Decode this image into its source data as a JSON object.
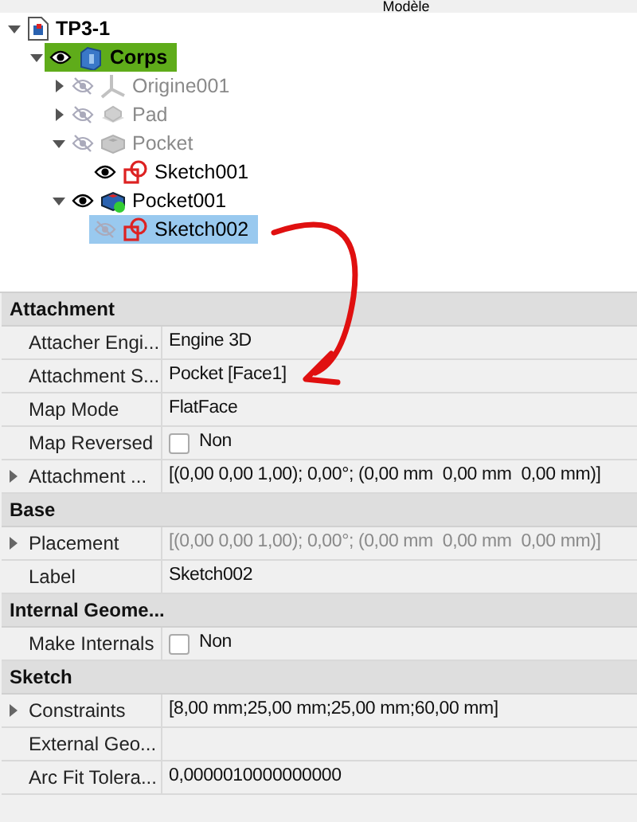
{
  "panel_title": "Modèle",
  "tree": [
    {
      "label": "TP3-1",
      "kind": "document",
      "expanded": true,
      "bold": true,
      "children": [
        {
          "label": "Corps",
          "kind": "body",
          "visible": true,
          "expanded": true,
          "bold": true,
          "active": true,
          "children": [
            {
              "label": "Origine001",
              "kind": "origin",
              "visible": false,
              "expanded": false,
              "dimmed": true,
              "has_children": true
            },
            {
              "label": "Pad",
              "kind": "pad",
              "visible": false,
              "expanded": false,
              "dimmed": true,
              "has_children": true
            },
            {
              "label": "Pocket",
              "kind": "pocket",
              "visible": false,
              "expanded": true,
              "dimmed": true,
              "children": [
                {
                  "label": "Sketch001",
                  "kind": "sketch",
                  "visible": true,
                  "dimmed": false
                }
              ]
            },
            {
              "label": "Pocket001",
              "kind": "pocket_tip",
              "visible": true,
              "expanded": true,
              "dimmed": false,
              "children": [
                {
                  "label": "Sketch002",
                  "kind": "sketch",
                  "visible": false,
                  "dimmed": false,
                  "selected": true
                }
              ]
            }
          ]
        }
      ]
    }
  ],
  "properties": [
    {
      "group": "Attachment",
      "rows": [
        {
          "name": "Attacher Engi...",
          "kind": "text",
          "value": "Engine 3D"
        },
        {
          "name": "Attachment S...",
          "kind": "text",
          "value": "Pocket [Face1]"
        },
        {
          "name": "Map Mode",
          "kind": "text",
          "value": "FlatFace"
        },
        {
          "name": "Map Reversed",
          "kind": "checkbox",
          "checked": false,
          "value": "Non"
        },
        {
          "name": "Attachment ...",
          "kind": "text",
          "expandable": true,
          "value": "[(0,00 0,00 1,00); 0,00°; (0,00 mm  0,00 mm  0,00 mm)]"
        }
      ]
    },
    {
      "group": "Base",
      "rows": [
        {
          "name": "Placement",
          "kind": "text",
          "expandable": true,
          "dimmed": true,
          "value": "[(0,00 0,00 1,00); 0,00°; (0,00 mm  0,00 mm  0,00 mm)]"
        },
        {
          "name": "Label",
          "kind": "text",
          "value": "Sketch002"
        }
      ]
    },
    {
      "group": "Internal Geome...",
      "rows": [
        {
          "name": "Make Internals",
          "kind": "checkbox",
          "checked": false,
          "value": "Non"
        }
      ]
    },
    {
      "group": "Sketch",
      "rows": [
        {
          "name": "Constraints",
          "kind": "text",
          "expandable": true,
          "value": "[8,00 mm;25,00 mm;25,00 mm;60,00 mm]"
        },
        {
          "name": "External Geo...",
          "kind": "empty"
        },
        {
          "name": "Arc Fit Tolera...",
          "kind": "text",
          "value": "0,0000010000000000"
        }
      ]
    }
  ]
}
